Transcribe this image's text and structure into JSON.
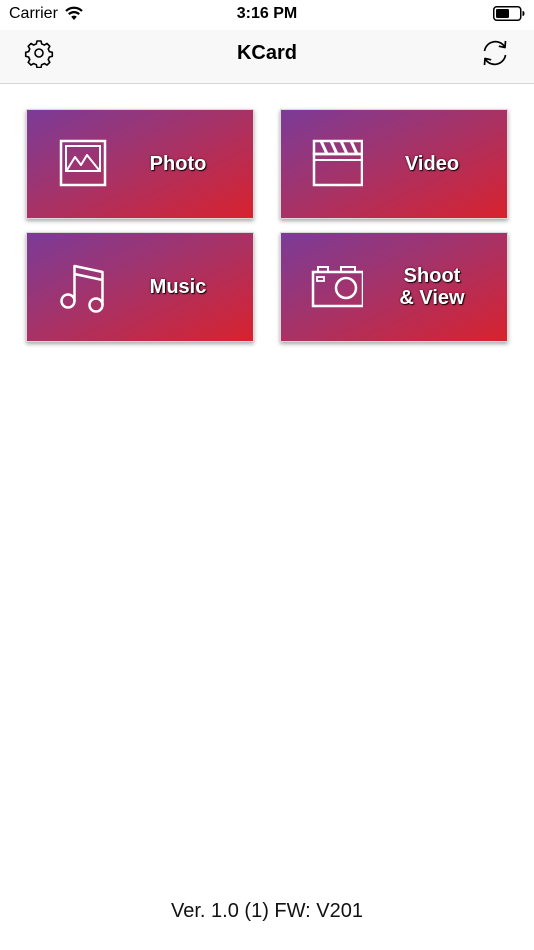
{
  "status_bar": {
    "carrier": "Carrier",
    "time": "3:16 PM",
    "wifi_icon": "wifi-icon",
    "battery_icon": "battery-icon"
  },
  "nav": {
    "title": "KCard",
    "left_icon": "gear-icon",
    "right_icon": "refresh-icon"
  },
  "tiles": [
    {
      "label": "Photo",
      "icon": "photo-icon"
    },
    {
      "label": "Video",
      "icon": "clapperboard-icon"
    },
    {
      "label": "Music",
      "icon": "music-note-icon"
    },
    {
      "label": "Shoot\n& View",
      "icon": "camera-icon"
    }
  ],
  "footer": {
    "version": "Ver. 1.0 (1) FW: V201"
  },
  "colors": {
    "tile_gradient_start": "#7b3b98",
    "tile_gradient_end": "#d8222e",
    "nav_background": "#f8f8f8"
  }
}
